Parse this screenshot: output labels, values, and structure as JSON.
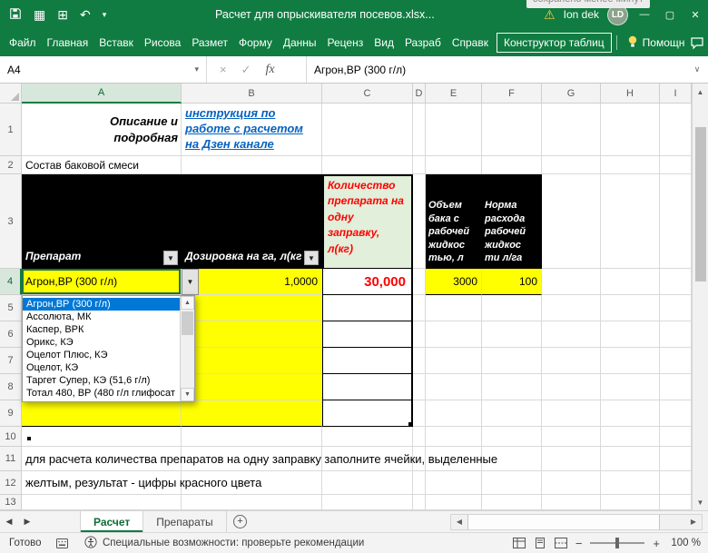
{
  "titlebar": {
    "saved_hint": "сохранено менее минут",
    "title": "Расчет для опрыскивателя посевов.xlsx...",
    "user": "Ion dek",
    "avatar": "LD"
  },
  "ribbon": {
    "tabs": [
      "Файл",
      "Главная",
      "Вставк",
      "Рисова",
      "Размет",
      "Форму",
      "Данны",
      "Реценз",
      "Вид",
      "Разраб",
      "Справк"
    ],
    "contextual_tab": "Конструктор таблиц",
    "assistant": "Помощн"
  },
  "formula_bar": {
    "name_box": "A4",
    "fx": "fx",
    "value": "Агрон,ВР (300 г/л)"
  },
  "columns": [
    "A",
    "B",
    "C",
    "D",
    "E",
    "F",
    "G",
    "H",
    "I"
  ],
  "rows": [
    "1",
    "2",
    "3",
    "4",
    "5",
    "6",
    "7",
    "8",
    "9",
    "10",
    "11",
    "12",
    "13"
  ],
  "cells": {
    "a1": "Описание и подробная",
    "b1_link": "инструкция по работе с расчетом на Дзен канале",
    "a2": "Состав баковой смеси",
    "a3": "Препарат",
    "b3": "Дозировка на га, л(кг",
    "c3": "Количество препарата на одну заправку, л(кг)",
    "e3": "Объем бака с рабочей жидкос тью, л",
    "f3": "Норма расхода рабочей жидкос ти л/га",
    "a4": "Агрон,ВР (300 г/л)",
    "b4": "1,0000",
    "c4": "30,000",
    "e4": "3000",
    "f4": "100",
    "note_line1": "для расчета количества препаратов на одну заправку заполните ячейки, выделенные",
    "note_line2": "желтым, результат - цифры красного цвета"
  },
  "dropdown": {
    "items": [
      "Агрон,ВР (300 г/л)",
      "Ассолюта, МК",
      "Каспер, ВРК",
      "Орикс, КЭ",
      "Оцелот Плюс, КЭ",
      "Оцелот, КЭ",
      "Таргет Супер, КЭ (51,6 г/л)",
      "Тотал 480, ВР (480 г/л глифосат"
    ]
  },
  "sheet_tabs": {
    "active": "Расчет",
    "inactive": "Препараты"
  },
  "status_bar": {
    "mode": "Готово",
    "accessibility": "Специальные возможности: проверьте рекомендации",
    "zoom": "100 %"
  },
  "colors": {
    "title_green": "#107C41",
    "selection_green": "#217346",
    "cell_yellow": "#FFFF00",
    "result_red": "#FF0000",
    "link_blue": "#0563C1",
    "highlight_blue": "#0078D7",
    "table_header_black": "#000000",
    "c3_light_green": "#E2EFDA"
  }
}
